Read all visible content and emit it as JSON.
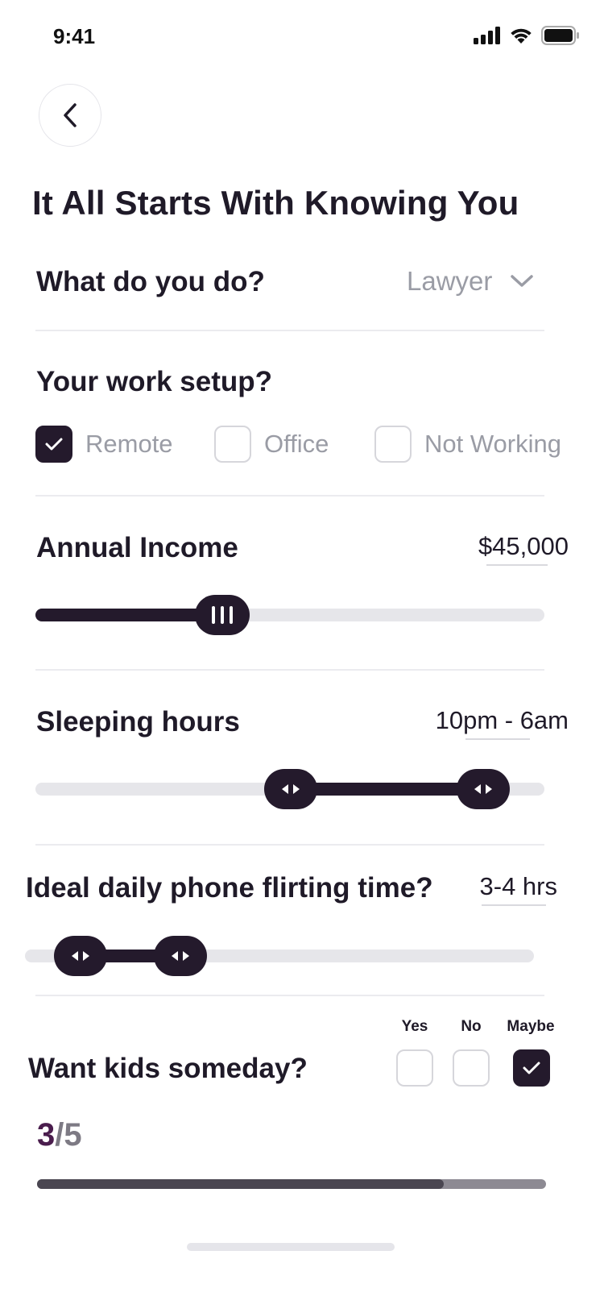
{
  "status_bar": {
    "time": "9:41"
  },
  "header": {
    "title": "It All Starts With Knowing You"
  },
  "occupation": {
    "label": "What do you do?",
    "value": "Lawyer"
  },
  "work_setup": {
    "label": "Your work setup?",
    "options": [
      {
        "label": "Remote",
        "checked": true
      },
      {
        "label": "Office",
        "checked": false
      },
      {
        "label": "Not Working",
        "checked": false
      }
    ]
  },
  "income": {
    "label": "Annual Income",
    "value": "$45,000"
  },
  "sleep": {
    "label": "Sleeping hours",
    "value": "10pm - 6am"
  },
  "flirting": {
    "label": "Ideal daily phone flirting time?",
    "value": "3-4 hrs"
  },
  "kids": {
    "label": "Want kids someday?",
    "options": [
      {
        "label": "Yes",
        "checked": false
      },
      {
        "label": "No",
        "checked": false
      },
      {
        "label": "Maybe",
        "checked": true
      }
    ]
  },
  "progress": {
    "current": "3",
    "separator": "/",
    "total": "5"
  },
  "colors": {
    "primary": "#241a2c",
    "muted": "#9a9ca5",
    "track": "#e6e6ea",
    "progress_current": "#4a1d4d"
  }
}
